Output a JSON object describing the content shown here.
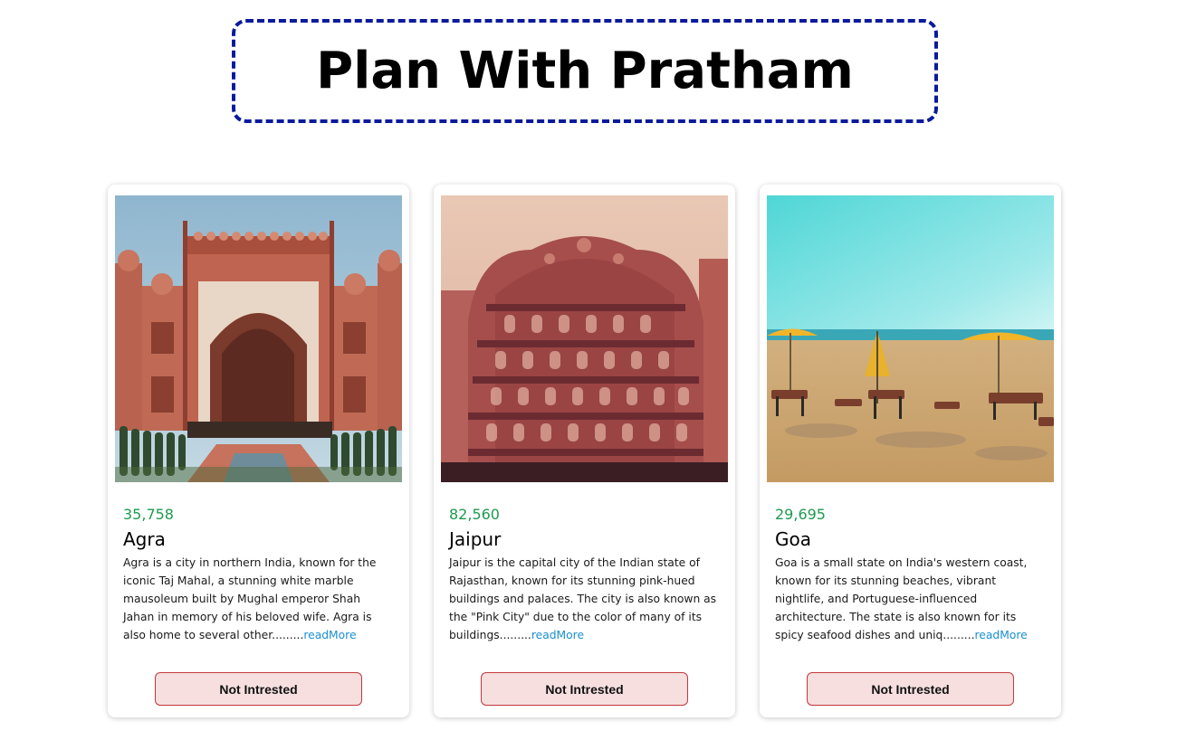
{
  "header": {
    "title": "Plan With Pratham"
  },
  "cards": [
    {
      "price": "35,758",
      "city": "Agra",
      "description": "Agra is a city in northern India, known for the iconic Taj Mahal, a stunning white marble mausoleum built by Mughal emperor Shah Jahan in memory of his beloved wife. Agra is also home to several other.........",
      "read_more": "readMore",
      "button": "Not Intrested"
    },
    {
      "price": "82,560",
      "city": "Jaipur",
      "description": "Jaipur is the capital city of the Indian state of Rajasthan, known for its stunning pink-hued buildings and palaces. The city is also known as the \"Pink City\" due to the color of many of its buildings.........",
      "read_more": "readMore",
      "button": "Not Intrested"
    },
    {
      "price": "29,695",
      "city": "Goa",
      "description": "Goa is a small state on India's western coast, known for its stunning beaches, vibrant nightlife, and Portuguese-influenced architecture. The state is also known for its spicy seafood dishes and uniq.........",
      "read_more": "readMore",
      "button": "Not Intrested"
    }
  ],
  "colors": {
    "title_border": "#0a1a9c",
    "price": "#1e9a50",
    "link": "#1a8fd0",
    "button_bg": "#f7dfdf",
    "button_border": "#c0393b"
  }
}
